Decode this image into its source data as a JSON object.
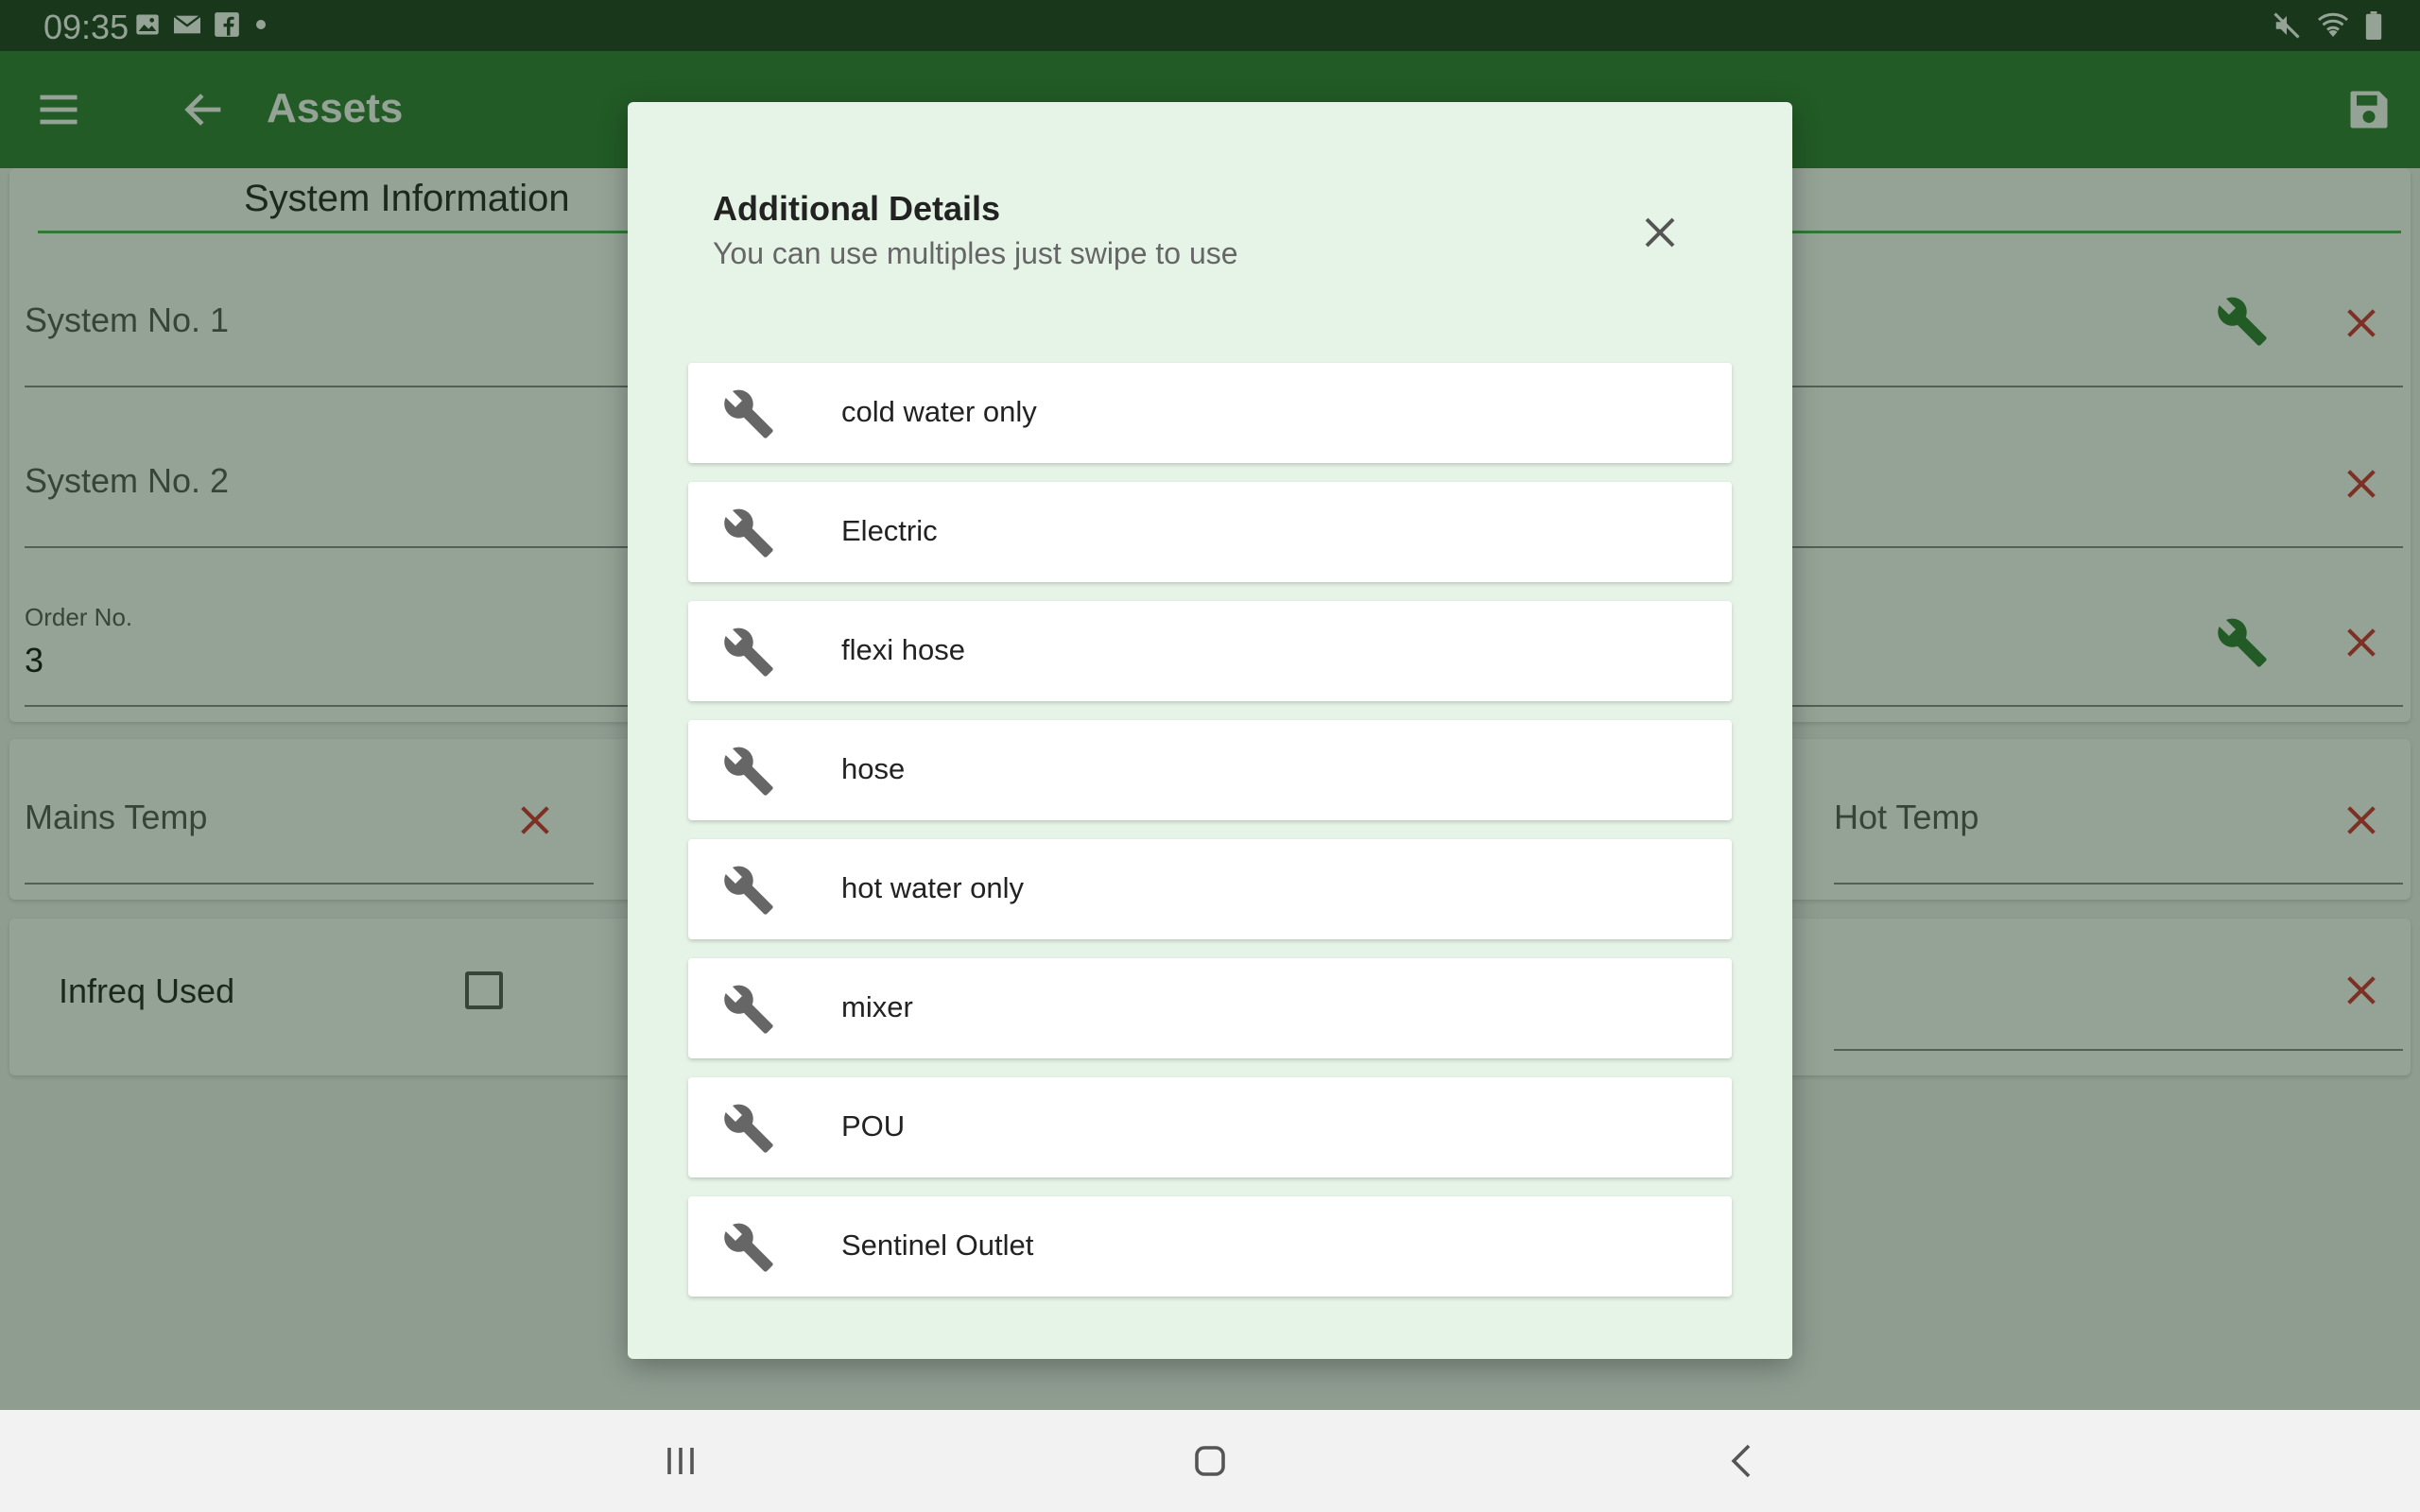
{
  "status_bar": {
    "time": "09:35",
    "left_icons": [
      "image-icon",
      "mail-icon",
      "facebook-icon",
      "dot-icon"
    ],
    "right_icons": [
      "mute-icon",
      "wifi-icon",
      "battery-icon"
    ]
  },
  "app_bar": {
    "title": "Assets",
    "color": "#2e7d32"
  },
  "form": {
    "section_title": "System Information",
    "system_no_1": {
      "label": "System No. 1"
    },
    "system_no_2": {
      "label": "System No. 2"
    },
    "order_no": {
      "label": "Order No.",
      "value": "3"
    },
    "mains_temp": {
      "label": "Mains Temp"
    },
    "hot_temp": {
      "label": "Hot Temp"
    },
    "infreq_used": {
      "label": "Infreq Used",
      "checked": false
    }
  },
  "dialog": {
    "title": "Additional Details",
    "subtitle": "You can use multiples just swipe to use",
    "items": [
      {
        "label": "cold water only",
        "icon": "wrench-icon"
      },
      {
        "label": "Electric",
        "icon": "wrench-icon"
      },
      {
        "label": "flexi hose",
        "icon": "wrench-icon"
      },
      {
        "label": "hose",
        "icon": "wrench-icon"
      },
      {
        "label": "hot water only",
        "icon": "wrench-icon"
      },
      {
        "label": "mixer",
        "icon": "wrench-icon"
      },
      {
        "label": "POU",
        "icon": "wrench-icon"
      },
      {
        "label": "Sentinel Outlet",
        "icon": "wrench-icon"
      }
    ]
  },
  "colors": {
    "accent_green": "#2e7d32",
    "clear_red": "#d32f2f",
    "dialog_bg": "#e6f4e7"
  }
}
